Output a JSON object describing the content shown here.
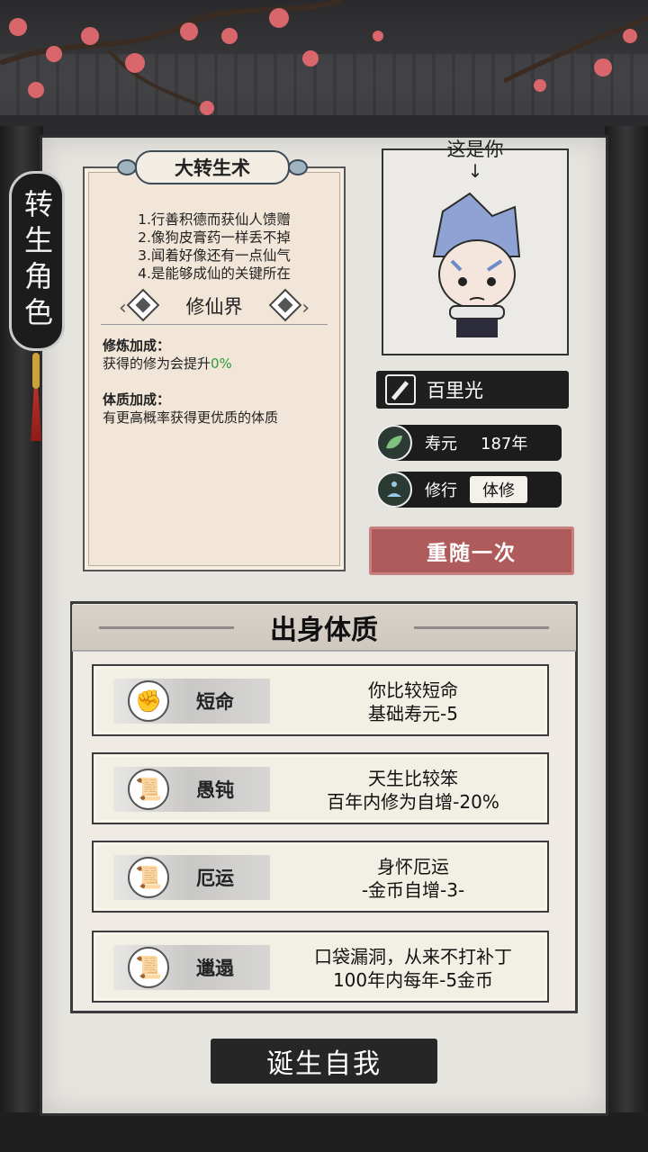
{
  "side_tag": "转生角色",
  "scroll": {
    "title": "大转生术",
    "tips": [
      "1.行善积德而获仙人馈赠",
      "2.像狗皮膏药一样丢不掉",
      "3.闻着好像还有一点仙气",
      "4.是能够成仙的关键所在"
    ],
    "realm": "修仙界",
    "cultivation_bonus_title": "修炼加成：",
    "cultivation_bonus_text": "获得的修为会提升",
    "cultivation_bonus_value": "0%",
    "physique_bonus_title": "体质加成：",
    "physique_bonus_text": "有更高概率获得更优质的体质"
  },
  "portrait": {
    "label": "这是你",
    "arrow": "↓"
  },
  "character": {
    "name": "百里光",
    "lifespan_label": "寿元",
    "lifespan_value": "187年",
    "cultivation_label": "修行",
    "cultivation_value": "体修"
  },
  "reroll_button": "重随一次",
  "origin": {
    "title": "出身体质",
    "traits": [
      {
        "name": "短命",
        "icon": "fist-icon",
        "line1": "你比较短命",
        "line2": "基础寿元-5"
      },
      {
        "name": "愚钝",
        "icon": "scroll-icon",
        "line1": "天生比较笨",
        "line2": "百年内修为自增-20%"
      },
      {
        "name": "厄运",
        "icon": "scroll-icon",
        "line1": "身怀厄运",
        "line2": "-金币自增-3-"
      },
      {
        "name": "邋遢",
        "icon": "scroll-icon",
        "line1": "口袋漏洞，从来不打补丁",
        "line2": "100年内每年-5金币"
      }
    ]
  },
  "birth_button": "诞生自我",
  "colors": {
    "reroll": "#b05b5b",
    "green_value": "#2d9c3a",
    "panel": "#e6e4df",
    "frame": "#1d1d1f"
  }
}
